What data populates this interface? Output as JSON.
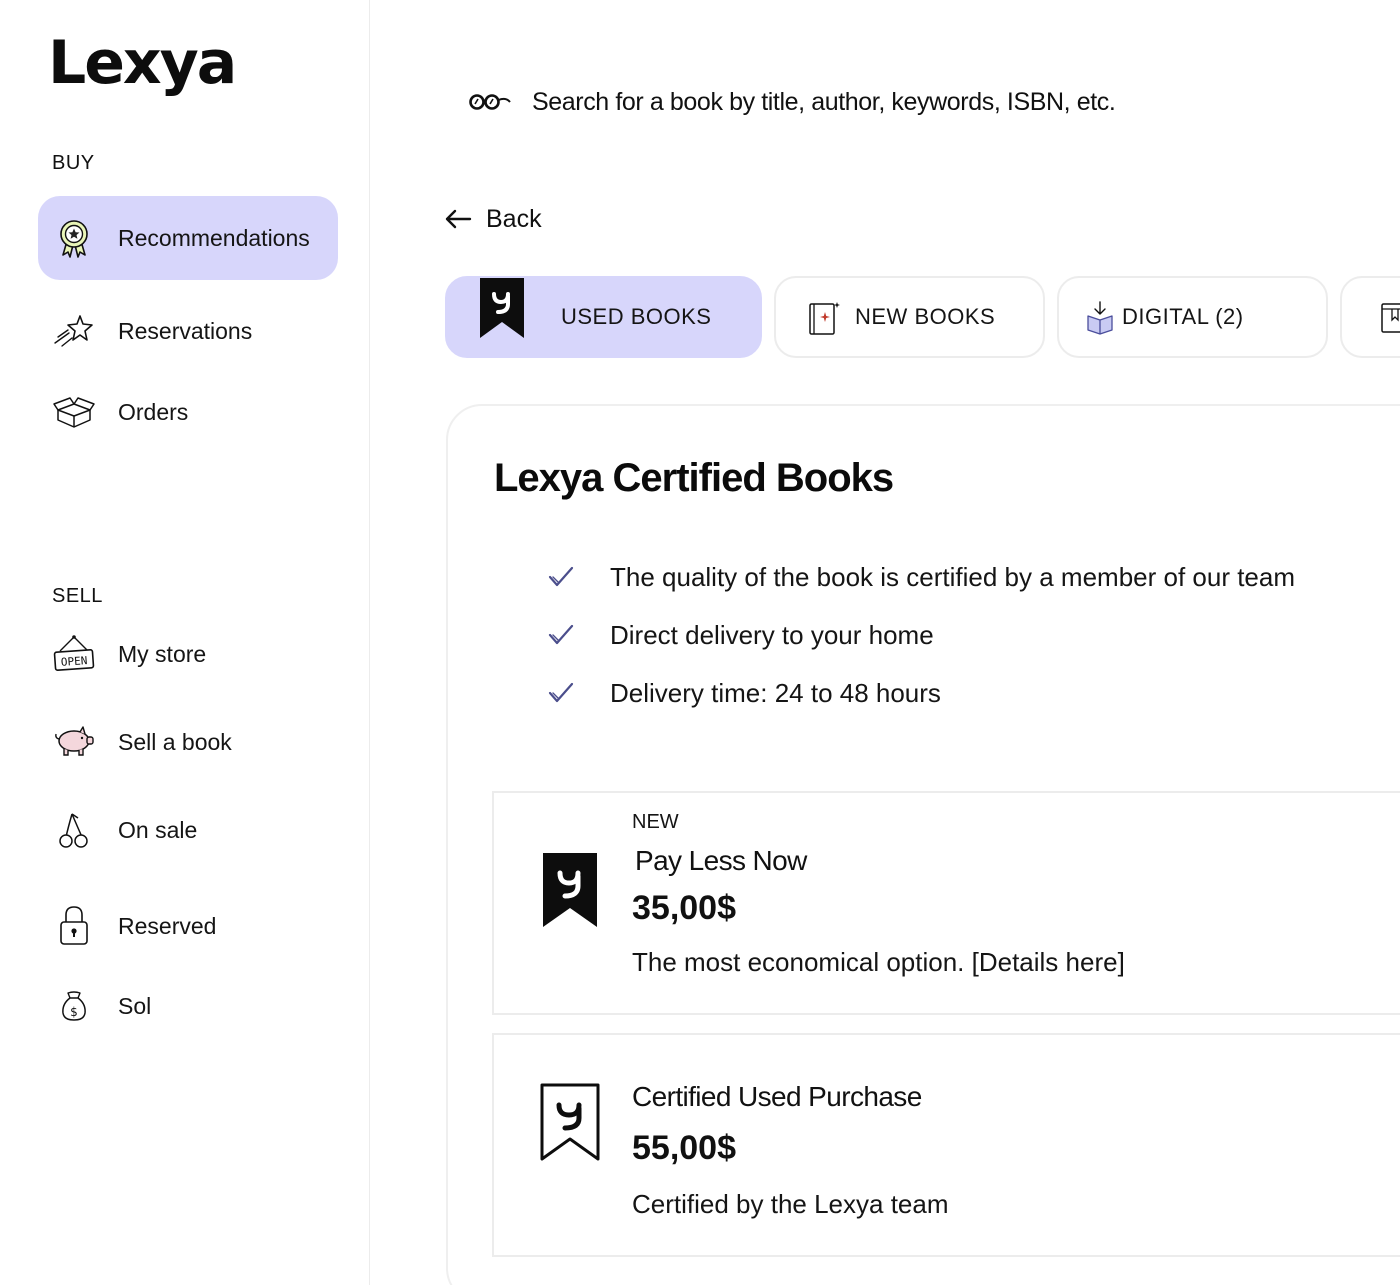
{
  "app": {
    "logo": "Lexya"
  },
  "sidebar": {
    "buy_label": "BUY",
    "sell_label": "SELL",
    "buy_items": [
      {
        "label": "Recommendations",
        "icon": "award-ribbon-icon",
        "active": true
      },
      {
        "label": "Reservations",
        "icon": "shooting-star-icon"
      },
      {
        "label": "Orders",
        "icon": "open-box-icon"
      }
    ],
    "sell_items": [
      {
        "label": "My store",
        "icon": "open-sign-icon"
      },
      {
        "label": "Sell a book",
        "icon": "piggy-bank-icon"
      },
      {
        "label": "On sale",
        "icon": "cherries-icon"
      },
      {
        "label": "Reserved",
        "icon": "padlock-icon"
      },
      {
        "label": "Sol",
        "icon": "money-bag-icon"
      }
    ]
  },
  "search": {
    "placeholder": "Search for a book by title, author, keywords, ISBN, etc.",
    "value": ""
  },
  "back": {
    "label": "Back"
  },
  "tabs": [
    {
      "label": "USED BOOKS",
      "icon": "lexya-bookmark-icon",
      "active": true
    },
    {
      "label": "NEW BOOKS",
      "icon": "sparkle-book-icon"
    },
    {
      "label": "DIGITAL (2)",
      "icon": "download-book-icon"
    }
  ],
  "card": {
    "title": "Lexya Certified Books",
    "features": [
      "The quality of the book is certified by a member of our team",
      "Direct delivery to your home",
      "Delivery time: 24 to 48 hours"
    ],
    "options": [
      {
        "badge": "NEW",
        "title": "Pay Less Now",
        "price": "35,00$",
        "description": "The most economical option. [Details here]",
        "icon": "lexya-bookmark-filled-icon"
      },
      {
        "title": "Certified Used Purchase",
        "price": "55,00$",
        "description": "Certified by the Lexya team",
        "icon": "lexya-bookmark-outline-icon"
      }
    ]
  },
  "colors": {
    "accent": "#d7d6fb",
    "text": "#111111",
    "border": "#ececec"
  }
}
